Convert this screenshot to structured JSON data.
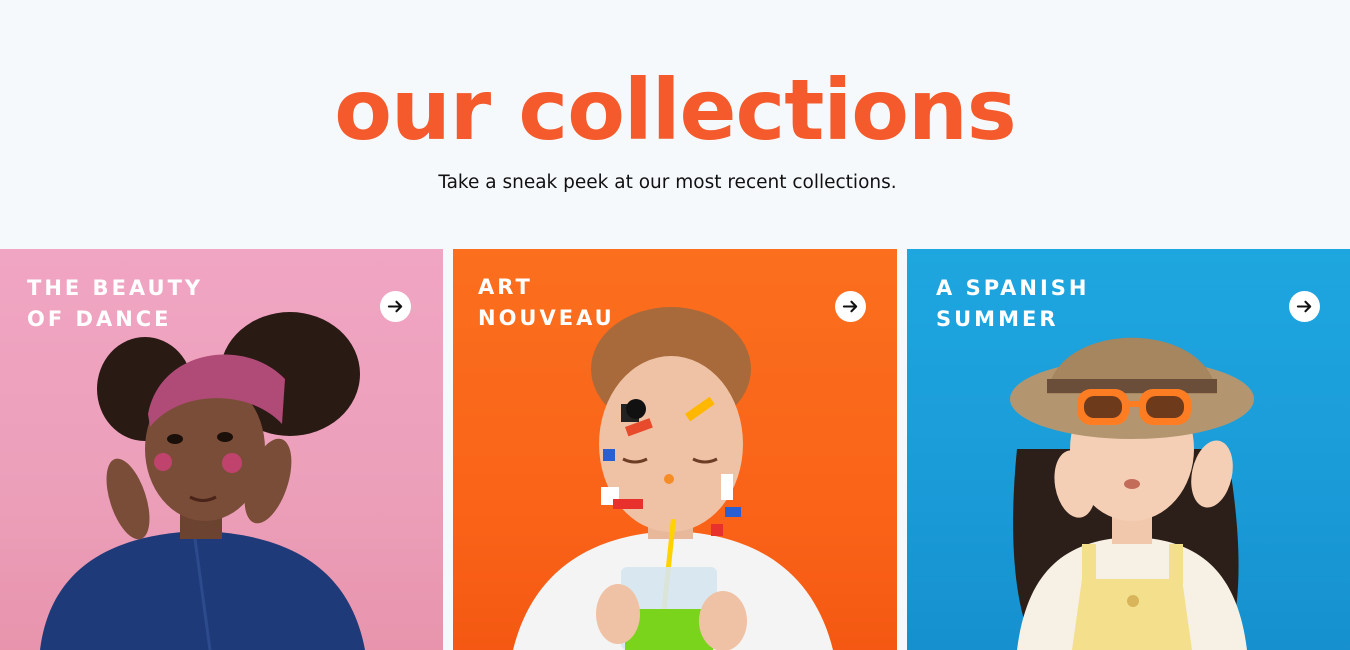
{
  "section": {
    "title": "our collections",
    "subtitle": "Take a sneak peek at our most recent collections."
  },
  "cards": [
    {
      "title_line1": "THE BEAUTY",
      "title_line2": "OF DANCE",
      "bg_color": "#f1a2c0",
      "icon": "arrow-right-icon"
    },
    {
      "title_line1": "ART",
      "title_line2": "NOUVEAU",
      "bg_color": "#fb6a1c",
      "icon": "arrow-right-icon"
    },
    {
      "title_line1": "A SPANISH",
      "title_line2": "SUMMER",
      "bg_color": "#1ea2dc",
      "icon": "arrow-right-icon"
    }
  ],
  "colors": {
    "accent": "#f45a2c",
    "page_bg": "#f6f9fc"
  }
}
